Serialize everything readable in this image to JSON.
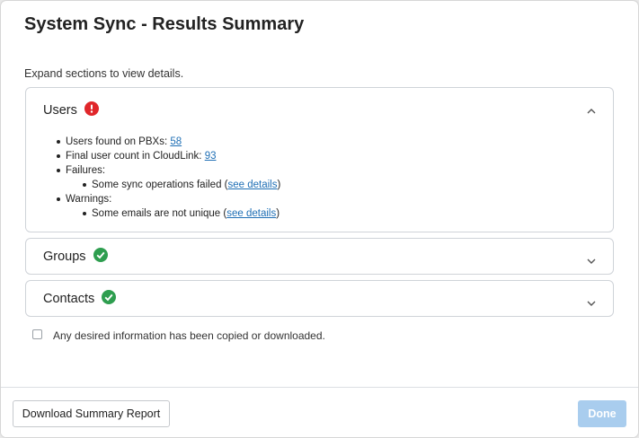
{
  "dialog": {
    "title": "System Sync - Results Summary",
    "instructions": "Expand sections to view details."
  },
  "sections": {
    "users": {
      "title": "Users",
      "status": "error",
      "expanded": true,
      "found_label": "Users found on PBXs: ",
      "found_value": "58",
      "final_label": "Final user count in CloudLink: ",
      "final_value": "93",
      "failures_label": "Failures:",
      "failure_text": "Some sync operations failed (",
      "failure_link": "see details",
      "failure_close": ")",
      "warnings_label": "Warnings:",
      "warning_text": "Some emails are not unique (",
      "warning_link": "see details",
      "warning_close": ")"
    },
    "groups": {
      "title": "Groups",
      "status": "ok",
      "expanded": false
    },
    "contacts": {
      "title": "Contacts",
      "status": "ok",
      "expanded": false
    }
  },
  "confirmation": {
    "label": "Any desired information has been copied or downloaded.",
    "checked": false
  },
  "footer": {
    "download_label": "Download Summary Report",
    "done_label": "Done",
    "done_enabled": false
  },
  "icons": {
    "error": "exclamation-circle-icon",
    "ok": "check-circle-icon",
    "expanded": "chevron-up-icon",
    "collapsed": "chevron-down-icon"
  },
  "colors": {
    "error": "#e0262a",
    "success": "#2e9e4f",
    "link": "#1f6fb5",
    "done_disabled": "#a9cdee"
  }
}
